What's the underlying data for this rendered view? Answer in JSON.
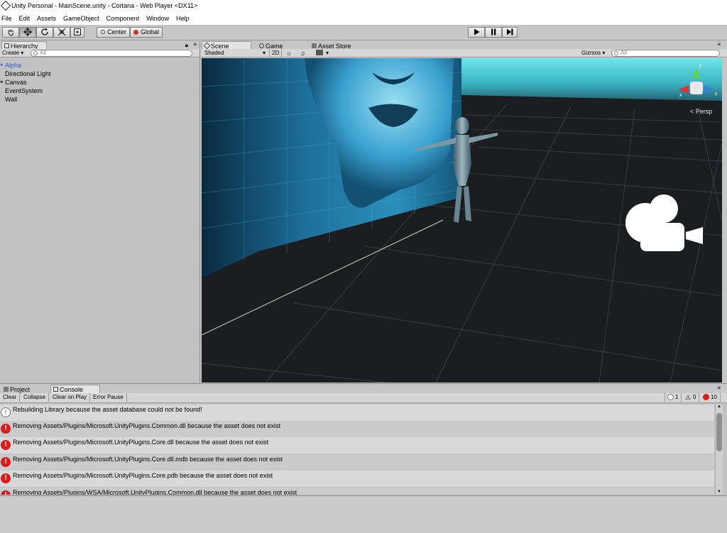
{
  "window": {
    "title": "Unity Personal - MainScene.unity - Cortana - Web Player <DX11>"
  },
  "menu": [
    "File",
    "Edit",
    "Assets",
    "GameObject",
    "Component",
    "Window",
    "Help"
  ],
  "toolbar": {
    "center_label": "Center",
    "global_label": "Global"
  },
  "hierarchy": {
    "tab_label": "Hierarchy",
    "create_label": "Create",
    "search_placeholder": "All",
    "items": [
      {
        "label": "Alpha",
        "expandable": true,
        "selected": true
      },
      {
        "label": "Directional Light",
        "expandable": false
      },
      {
        "label": "Canvas",
        "expandable": true
      },
      {
        "label": "EventSystem",
        "expandable": false
      },
      {
        "label": "Wall",
        "expandable": false
      }
    ]
  },
  "scene": {
    "tabs": [
      "Scene",
      "Game",
      "Asset Store"
    ],
    "shading_label": "Shaded",
    "mode_2d_label": "2D",
    "gizmos_label": "Gizmos",
    "search_placeholder": "All",
    "persp_label": "Persp",
    "axis_labels": {
      "y": "y",
      "z": "z",
      "x": "x"
    }
  },
  "bottom": {
    "tabs": [
      "Project",
      "Console"
    ],
    "buttons": [
      "Clear",
      "Collapse",
      "Clear on Play",
      "Error Pause"
    ],
    "counts": {
      "info": "1",
      "warn": "0",
      "error": "10"
    },
    "messages": [
      {
        "type": "info",
        "text": "Rebuilding Library because the asset database could not be found!"
      },
      {
        "type": "error",
        "text": "Removing Assets/Plugins/Microsoft.UnityPlugins.Common.dll because the asset does not exist"
      },
      {
        "type": "error",
        "text": "Removing Assets/Plugins/Microsoft.UnityPlugins.Core.dll because the asset does not exist"
      },
      {
        "type": "error",
        "text": "Removing Assets/Plugins/Microsoft.UnityPlugins.Core.dll.mdb because the asset does not exist"
      },
      {
        "type": "error",
        "text": "Removing Assets/Plugins/Microsoft.UnityPlugins.Core.pdb because the asset does not exist"
      },
      {
        "type": "error",
        "text": "Removing Assets/Plugins/WSA/Microsoft.UnityPlugins.Common.dll because the asset does not exist"
      }
    ]
  },
  "colors": {
    "selected_text": "#2f5bd1",
    "error": "#d81c1c",
    "wall": "#2a8fb8",
    "sky": "#3fb8c8"
  }
}
